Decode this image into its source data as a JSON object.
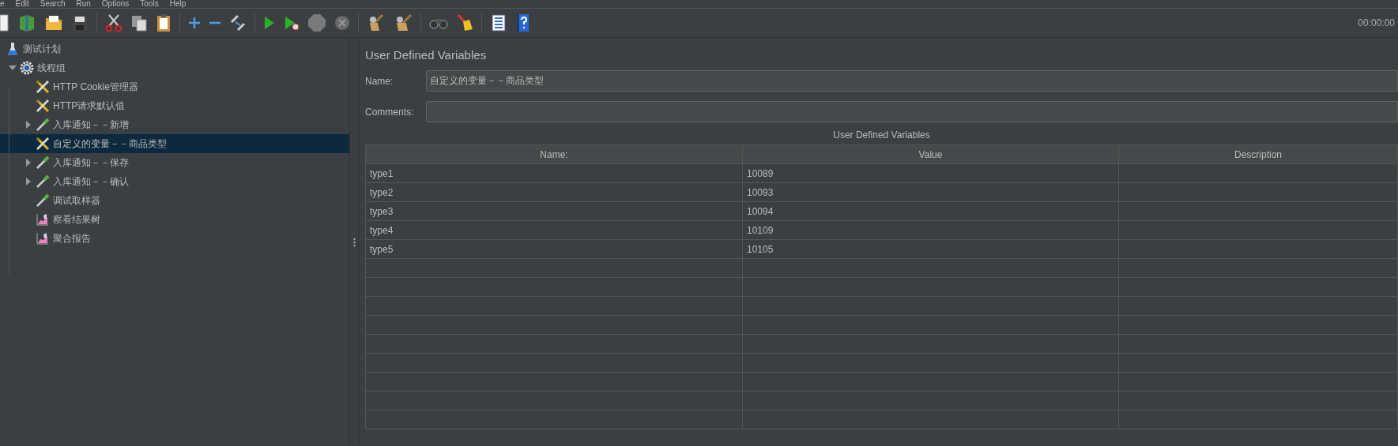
{
  "menu": [
    "e",
    "Edit",
    "Search",
    "Run",
    "Options",
    "Tools",
    "Help"
  ],
  "toolbar": {
    "timer": "00:00:00"
  },
  "tree": [
    {
      "label": "测试计划",
      "kind": "plan",
      "selected": false,
      "children": [
        {
          "label": "线程组",
          "kind": "thread_group",
          "selected": false,
          "expanded": true,
          "children": [
            {
              "label": "HTTP Cookie管理器",
              "kind": "config",
              "selected": false
            },
            {
              "label": "HTTP请求默认值",
              "kind": "config",
              "selected": false
            },
            {
              "label": "入库通知－－新增",
              "kind": "sampler",
              "selected": false,
              "expanded": false
            },
            {
              "label": "自定义的变量－－商品类型",
              "kind": "config",
              "selected": true
            },
            {
              "label": "入库通知－－保存",
              "kind": "sampler",
              "selected": false,
              "expanded": false
            },
            {
              "label": "入库通知－－确认",
              "kind": "sampler",
              "selected": false,
              "expanded": false
            },
            {
              "label": "调试取样器",
              "kind": "sampler",
              "selected": false
            },
            {
              "label": "察看结果树",
              "kind": "listener",
              "selected": false
            },
            {
              "label": "聚合报告",
              "kind": "listener",
              "selected": false
            }
          ]
        }
      ]
    }
  ],
  "panel": {
    "title": "User Defined Variables",
    "name_label": "Name:",
    "name_value": "自定义的变量－－商品类型",
    "comments_label": "Comments:",
    "table": {
      "caption": "User Defined Variables",
      "columns": [
        "Name:",
        "Value",
        "Description"
      ],
      "rows": [
        {
          "name": "type1",
          "value": "10089"
        },
        {
          "name": "type2",
          "value": "10093"
        },
        {
          "name": "type3",
          "value": "10094"
        },
        {
          "name": "type4",
          "value": "10109"
        },
        {
          "name": "type5",
          "value": "10105"
        }
      ]
    }
  }
}
